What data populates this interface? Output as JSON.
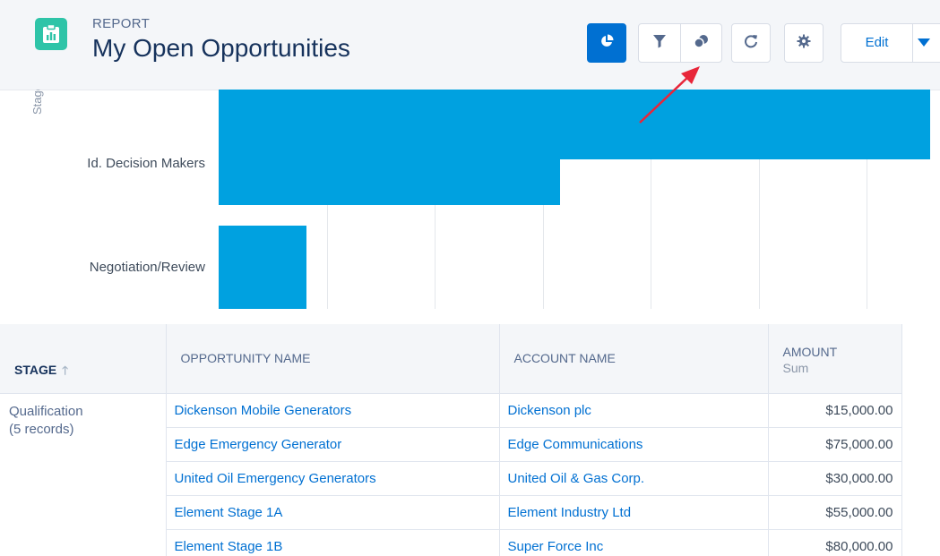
{
  "header": {
    "object_type": "REPORT",
    "title": "My Open Opportunities",
    "icons": {
      "report": "report-icon",
      "chart": "chart-icon",
      "filter": "filter-icon",
      "shapes": "shapes-icon",
      "refresh": "refresh-icon",
      "settings": "gear-icon",
      "more": "chevron-down-icon"
    },
    "edit_label": "Edit"
  },
  "chart_data": {
    "type": "bar",
    "orientation": "horizontal",
    "ylabel": "Stage",
    "categories": [
      "",
      "Id. Decision Makers",
      "Negotiation/Review"
    ],
    "values": [
      100,
      48,
      12.3
    ],
    "xlim": [
      0,
      100
    ],
    "grid": true
  },
  "table": {
    "columns": [
      {
        "label": "STAGE"
      },
      {
        "label": "OPPORTUNITY NAME"
      },
      {
        "label": "ACCOUNT NAME"
      },
      {
        "label": "AMOUNT",
        "sub": "Sum"
      }
    ],
    "group": {
      "stage": "Qualification",
      "count": "(5 records)"
    },
    "rows": [
      {
        "opportunity": "Dickenson Mobile Generators",
        "account": "Dickenson plc",
        "amount": "$15,000.00"
      },
      {
        "opportunity": "Edge Emergency Generator",
        "account": "Edge Communications",
        "amount": "$75,000.00"
      },
      {
        "opportunity": "United Oil Emergency Generators",
        "account": "United Oil & Gas Corp.",
        "amount": "$30,000.00"
      },
      {
        "opportunity": "Element Stage 1A",
        "account": "Element Industry Ltd",
        "amount": "$55,000.00"
      },
      {
        "opportunity": "Element Stage 1B",
        "account": "Super Force Inc",
        "amount": "$80,000.00"
      }
    ]
  },
  "colors": {
    "accent": "#0070d2",
    "bar": "#00a1e0",
    "icon_bg": "#2ec4a8",
    "annotation_arrow": "#e8263a"
  }
}
